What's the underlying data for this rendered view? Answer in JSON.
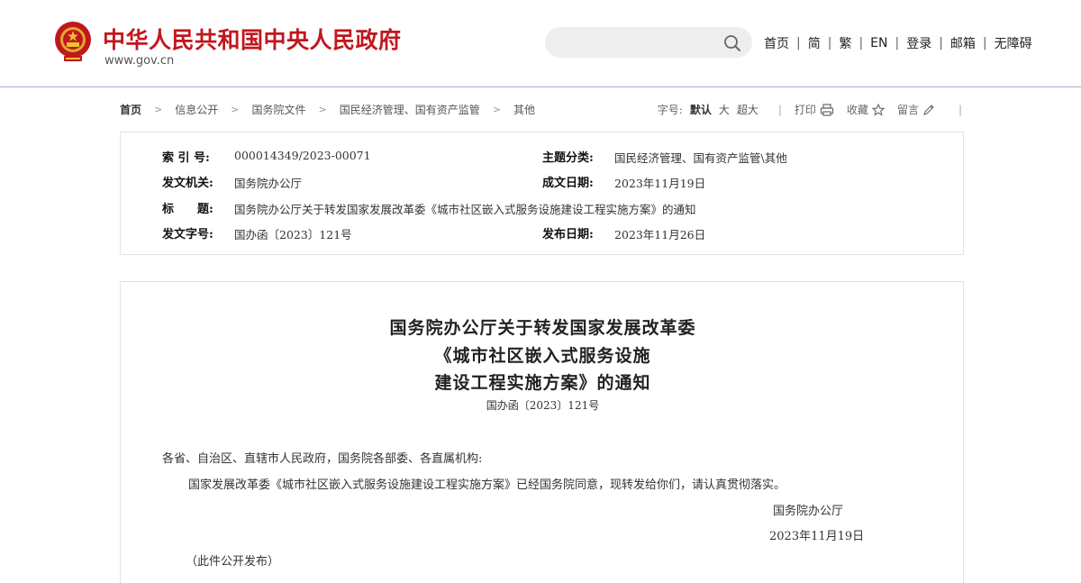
{
  "header": {
    "site_title": "中华人民共和国中央人民政府",
    "site_url": "www.gov.cn",
    "search_value": "",
    "nav": [
      "首页",
      "简",
      "繁",
      "EN",
      "登录",
      "邮箱",
      "无障碍"
    ],
    "colors": {
      "brand_red": "#c1171e",
      "header_rule": "#9fb3d1",
      "search_bg": "#eeeeee"
    }
  },
  "breadcrumb": [
    "首页",
    "信息公开",
    "国务院文件",
    "国民经济管理、国有资产监管",
    "其他"
  ],
  "tools": {
    "font_size_label": "字号:",
    "font_sizes": [
      "默认",
      "大",
      "超大"
    ],
    "print": "打印",
    "favorite": "收藏",
    "comment": "留言"
  },
  "meta": {
    "index_label": "索 引 号:",
    "index_value": "000014349/2023-00071",
    "topic_label": "主题分类:",
    "topic_value": "国民经济管理、国有资产监管\\其他",
    "issuer_label": "发文机关:",
    "issuer_value": "国务院办公厅",
    "written_label": "成文日期:",
    "written_value": "2023年11月19日",
    "title_label": "标　　题:",
    "title_value": "国务院办公厅关于转发国家发展改革委《城市社区嵌入式服务设施建设工程实施方案》的通知",
    "docno_label": "发文字号:",
    "docno_value": "国办函〔2023〕121号",
    "published_label": "发布日期:",
    "published_value": "2023年11月26日"
  },
  "article": {
    "title_lines": [
      "国务院办公厅关于转发国家发展改革委",
      "《城市社区嵌入式服务设施",
      "建设工程实施方案》的通知"
    ],
    "doc_number": "国办函〔2023〕121号",
    "salutation": "各省、自治区、直辖市人民政府，国务院各部委、各直属机构:",
    "paragraph": "国家发展改革委《城市社区嵌入式服务设施建设工程实施方案》已经国务院同意，现转发给你们，请认真贯彻落实。",
    "signature": "国务院办公厅",
    "date": "2023年11月19日",
    "note": "（此件公开发布）"
  }
}
